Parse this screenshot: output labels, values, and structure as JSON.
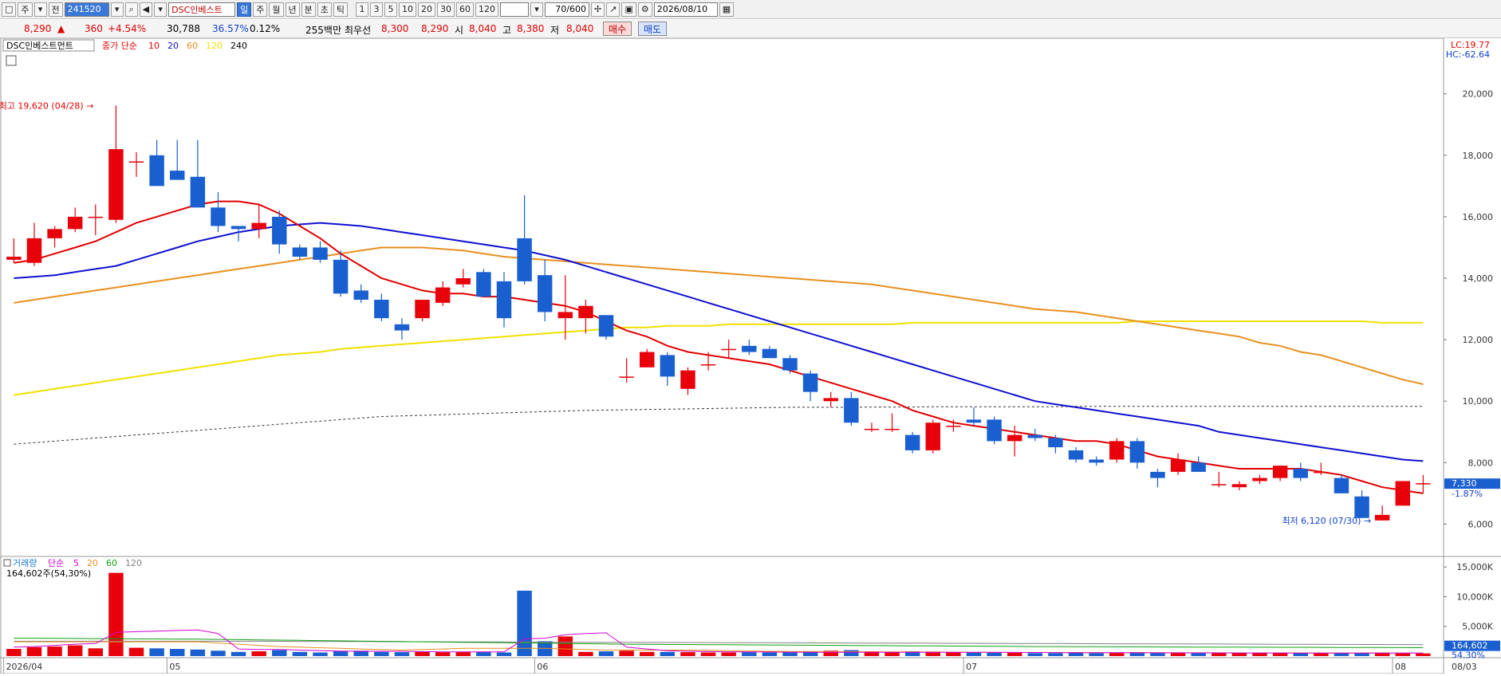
{
  "toolbar": {
    "items": [
      {
        "name": "window-menu-icon",
        "label": "□"
      },
      {
        "name": "market-select",
        "label": "주"
      },
      {
        "name": "market-dropdown-icon",
        "label": "▾"
      },
      {
        "name": "prev-button",
        "label": "전"
      }
    ],
    "code": "241520",
    "name": "DSC인베스트",
    "period_buttons": [
      "일",
      "주",
      "월",
      "년",
      "분",
      "초",
      "틱"
    ],
    "interval_buttons": [
      "1",
      "3",
      "5",
      "10",
      "20",
      "30",
      "60",
      "120"
    ],
    "count": "70/600",
    "date": "2026/08/10",
    "colors": {
      "accent": "#3a78d8"
    }
  },
  "quote": {
    "price": "8,290",
    "change_arrow": "▲",
    "change": "360",
    "change_pct": "+4.54%",
    "volume": "30,788",
    "vol_ratio": "36.57%",
    "turnover": "0.12%",
    "amount": "255백만",
    "best_ask_label": "최우선",
    "best_ask": "8,300",
    "best_bid": "8,290",
    "open_label": "시",
    "open": "8,040",
    "high_label": "고",
    "high": "8,380",
    "low_label": "저",
    "low": "8,040",
    "buy_label": "매수",
    "sell_label": "매도"
  },
  "chart_data": {
    "type": "candlestick",
    "title": "DSC인베스트먼트",
    "ma_legend": {
      "label": "종가 단순",
      "periods": [
        "10",
        "20",
        "60",
        "120",
        "240"
      ],
      "colors": [
        "#e00000",
        "#1010d0",
        "#e89020",
        "#f0e000",
        "#000000"
      ]
    },
    "lc_label": "LC:19.77",
    "hc_label": "HC:-62.64",
    "y_ticks": [
      "20,000",
      "18,000",
      "16,000",
      "14,000",
      "12,000",
      "10,000",
      "8,000",
      "6,000"
    ],
    "ylim": [
      5000,
      21600
    ],
    "max_annotation": "최고 19,620 (04/28)",
    "min_annotation": "최저 6,120 (07/30)",
    "current_price_label": "7,330",
    "current_change_label": "-1.87%",
    "x_labels": [
      {
        "label": "2026/04",
        "index": 0
      },
      {
        "label": "05",
        "index": 8
      },
      {
        "label": "06",
        "index": 26
      },
      {
        "label": "07",
        "index": 47
      },
      {
        "label": "08",
        "index": 68
      },
      {
        "label": "08/03",
        "index": 73
      }
    ],
    "candles": [
      [
        14600,
        15300,
        14500,
        14700
      ],
      [
        14500,
        15800,
        14400,
        15300
      ],
      [
        15300,
        15700,
        15000,
        15600
      ],
      [
        15600,
        16300,
        15500,
        16000
      ],
      [
        16000,
        16400,
        15400,
        16000
      ],
      [
        15900,
        19620,
        15800,
        18200
      ],
      [
        17800,
        18100,
        17300,
        17800
      ],
      [
        18000,
        18500,
        17000,
        17000
      ],
      [
        17500,
        18500,
        17200,
        17200
      ],
      [
        17300,
        18500,
        16400,
        16300
      ],
      [
        16300,
        16800,
        15500,
        15700
      ],
      [
        15700,
        15700,
        15200,
        15600
      ],
      [
        15600,
        16400,
        15300,
        15800
      ],
      [
        16000,
        16200,
        14800,
        15100
      ],
      [
        15000,
        15100,
        14600,
        14700
      ],
      [
        15000,
        15200,
        14500,
        14600
      ],
      [
        14600,
        14900,
        13400,
        13500
      ],
      [
        13600,
        13800,
        13200,
        13300
      ],
      [
        13300,
        13500,
        12600,
        12700
      ],
      [
        12500,
        12700,
        12000,
        12300
      ],
      [
        12700,
        13300,
        12600,
        13300
      ],
      [
        13200,
        13900,
        13100,
        13700
      ],
      [
        13800,
        14300,
        13700,
        14000
      ],
      [
        14200,
        14300,
        13400,
        13400
      ],
      [
        13900,
        14200,
        12400,
        12700
      ],
      [
        15300,
        16700,
        13800,
        13900
      ],
      [
        14100,
        14600,
        12600,
        12900
      ],
      [
        12700,
        14100,
        12000,
        12900
      ],
      [
        12700,
        13300,
        12200,
        13100
      ],
      [
        12800,
        12800,
        12000,
        12100
      ],
      [
        10800,
        11400,
        10600,
        10800
      ],
      [
        11100,
        11700,
        11100,
        11600
      ],
      [
        11500,
        11600,
        10500,
        10800
      ],
      [
        10400,
        11100,
        10200,
        11000
      ],
      [
        11200,
        11600,
        11000,
        11200
      ],
      [
        11700,
        12000,
        11400,
        11700
      ],
      [
        11800,
        12000,
        11500,
        11600
      ],
      [
        11700,
        11800,
        11400,
        11400
      ],
      [
        11400,
        11500,
        10900,
        11000
      ],
      [
        10900,
        11000,
        10000,
        10300
      ],
      [
        10000,
        10300,
        9800,
        10100
      ],
      [
        10100,
        10300,
        9200,
        9300
      ],
      [
        9100,
        9300,
        9000,
        9100
      ],
      [
        9100,
        9600,
        9000,
        9100
      ],
      [
        8900,
        9000,
        8300,
        8400
      ],
      [
        8400,
        9400,
        8300,
        9300
      ],
      [
        9200,
        9400,
        9000,
        9200
      ],
      [
        9400,
        9800,
        9200,
        9300
      ],
      [
        9400,
        9500,
        8600,
        8700
      ],
      [
        8700,
        9200,
        8200,
        8900
      ],
      [
        8900,
        9100,
        8700,
        8800
      ],
      [
        8800,
        8900,
        8300,
        8500
      ],
      [
        8400,
        8500,
        8000,
        8100
      ],
      [
        8100,
        8200,
        7900,
        8000
      ],
      [
        8100,
        8800,
        8000,
        8700
      ],
      [
        8700,
        8800,
        7800,
        8000
      ],
      [
        7700,
        7800,
        7200,
        7500
      ],
      [
        7700,
        8300,
        7600,
        8100
      ],
      [
        8000,
        8200,
        7700,
        7700
      ],
      [
        7300,
        7700,
        7200,
        7300
      ],
      [
        7200,
        7400,
        7100,
        7300
      ],
      [
        7400,
        7600,
        7300,
        7500
      ],
      [
        7500,
        7900,
        7400,
        7900
      ],
      [
        7800,
        8000,
        7400,
        7500
      ],
      [
        7700,
        8000,
        7600,
        7700
      ],
      [
        7500,
        7600,
        7000,
        7000
      ],
      [
        6900,
        7100,
        6200,
        6200
      ],
      [
        6120,
        6600,
        6120,
        6300
      ],
      [
        6600,
        7400,
        6600,
        7400
      ],
      [
        7300,
        7600,
        7000,
        7330
      ]
    ],
    "ma10": [
      14500,
      14600,
      14800,
      15000,
      15200,
      15500,
      15800,
      16000,
      16200,
      16400,
      16500,
      16500,
      16400,
      16100,
      15700,
      15300,
      14800,
      14400,
      14000,
      13800,
      13600,
      13500,
      13500,
      13400,
      13400,
      13300,
      13200,
      13100,
      12900,
      12600,
      12300,
      12100,
      11800,
      11600,
      11500,
      11400,
      11300,
      11200,
      11000,
      10800,
      10600,
      10400,
      10200,
      10000,
      9700,
      9500,
      9300,
      9200,
      9100,
      9000,
      8900,
      8800,
      8700,
      8700,
      8600,
      8400,
      8200,
      8100,
      8000,
      7900,
      7800,
      7800,
      7800,
      7800,
      7700,
      7600,
      7400,
      7200,
      7100,
      7000
    ],
    "ma20": [
      14000,
      14050,
      14100,
      14200,
      14300,
      14400,
      14600,
      14800,
      15000,
      15200,
      15350,
      15500,
      15600,
      15700,
      15750,
      15800,
      15750,
      15700,
      15600,
      15500,
      15400,
      15300,
      15200,
      15100,
      15000,
      14900,
      14750,
      14600,
      14400,
      14200,
      14000,
      13800,
      13600,
      13400,
      13200,
      13000,
      12800,
      12600,
      12400,
      12200,
      12000,
      11800,
      11600,
      11400,
      11200,
      11000,
      10800,
      10600,
      10400,
      10200,
      10000,
      9900,
      9800,
      9700,
      9600,
      9500,
      9400,
      9300,
      9200,
      9000,
      8900,
      8800,
      8700,
      8600,
      8500,
      8400,
      8300,
      8200,
      8100,
      8050
    ],
    "ma60": [
      13200,
      13300,
      13400,
      13500,
      13600,
      13700,
      13800,
      13900,
      14000,
      14100,
      14200,
      14300,
      14400,
      14500,
      14600,
      14700,
      14800,
      14900,
      15000,
      15000,
      15000,
      14950,
      14900,
      14800,
      14700,
      14650,
      14600,
      14550,
      14500,
      14450,
      14400,
      14350,
      14300,
      14250,
      14200,
      14150,
      14100,
      14050,
      14000,
      13950,
      13900,
      13850,
      13800,
      13700,
      13600,
      13500,
      13400,
      13300,
      13200,
      13100,
      13000,
      12950,
      12900,
      12800,
      12700,
      12600,
      12500,
      12400,
      12300,
      12200,
      12100,
      11900,
      11800,
      11600,
      11500,
      11300,
      11100,
      10900,
      10700,
      10550
    ],
    "ma120": [
      10200,
      10300,
      10400,
      10500,
      10600,
      10700,
      10800,
      10900,
      11000,
      11100,
      11200,
      11300,
      11400,
      11500,
      11550,
      11600,
      11700,
      11750,
      11800,
      11850,
      11900,
      11950,
      12000,
      12050,
      12100,
      12150,
      12200,
      12250,
      12300,
      12350,
      12400,
      12400,
      12450,
      12450,
      12450,
      12500,
      12500,
      12500,
      12500,
      12500,
      12500,
      12500,
      12500,
      12500,
      12550,
      12550,
      12550,
      12550,
      12550,
      12550,
      12550,
      12550,
      12550,
      12550,
      12550,
      12600,
      12600,
      12600,
      12600,
      12600,
      12600,
      12600,
      12600,
      12600,
      12600,
      12600,
      12600,
      12550,
      12550,
      12550
    ],
    "ma240": [
      8600,
      8650,
      8700,
      8750,
      8800,
      8850,
      8900,
      8950,
      9000,
      9050,
      9100,
      9150,
      9200,
      9250,
      9300,
      9350,
      9400,
      9450,
      9500,
      9520,
      9540,
      9560,
      9580,
      9600,
      9620,
      9640,
      9660,
      9680,
      9700,
      9710,
      9720,
      9730,
      9740,
      9750,
      9760,
      9770,
      9780,
      9790,
      9800,
      9800,
      9800,
      9800,
      9810,
      9810,
      9810,
      9820,
      9820,
      9820,
      9820,
      9820,
      9820,
      9820,
      9830,
      9830,
      9830,
      9830,
      9830,
      9830,
      9830,
      9830,
      9830,
      9830,
      9830,
      9830,
      9830,
      9830,
      9830,
      9830,
      9830,
      9830
    ]
  },
  "volume_panel": {
    "label": "거래량",
    "ma_label": "단순",
    "ma_periods": [
      "5",
      "20",
      "60",
      "120"
    ],
    "ma_colors": [
      "#d000d0",
      "#e89020",
      "#10a010",
      "#808080"
    ],
    "info": "164,602주(54,30%)",
    "y_ticks": [
      "15,000K",
      "10,000K",
      "5,000K"
    ],
    "ylim": [
      0,
      16500
    ],
    "current_volume_label": "164,602",
    "current_pct_label": "54.30%",
    "volumes": [
      1200,
      1500,
      1600,
      1800,
      1300,
      14000,
      1400,
      1300,
      1200,
      1100,
      900,
      700,
      800,
      1000,
      700,
      600,
      800,
      900,
      700,
      650,
      700,
      650,
      700,
      700,
      600,
      11000,
      2500,
      3300,
      700,
      800,
      900,
      700,
      700,
      650,
      600,
      600,
      650,
      600,
      700,
      800,
      900,
      1000,
      800,
      700,
      800,
      750,
      700,
      650,
      600,
      550,
      500,
      500,
      550,
      500,
      600,
      650,
      550,
      550,
      500,
      500,
      500,
      550,
      500,
      500,
      500,
      500,
      550,
      600,
      500,
      450
    ],
    "ma5": [
      1500,
      1600,
      1800,
      2000,
      2100,
      4000,
      4100,
      4200,
      4300,
      4400,
      3800,
      1200,
      1100,
      1100,
      1000,
      900,
      850,
      800,
      800,
      800,
      750,
      700,
      700,
      700,
      700,
      2900,
      3000,
      3600,
      3800,
      3900,
      1500,
      1200,
      900,
      800,
      750,
      700,
      700,
      680,
      660,
      650,
      650,
      650,
      650,
      650,
      650,
      650,
      650,
      650,
      640,
      620,
      600,
      590,
      580,
      570,
      560,
      550,
      550,
      550,
      540,
      530,
      520,
      520,
      520,
      510,
      510,
      510,
      510,
      510,
      500,
      500
    ],
    "ma20": [
      2400,
      2400,
      2400,
      2400,
      2400,
      2400,
      2400,
      2400,
      2400,
      2400,
      2200,
      2000,
      1800,
      1600,
      1500,
      1400,
      1300,
      1200,
      1100,
      1000,
      1100,
      1200,
      1300,
      1300,
      1300,
      1300,
      1300,
      1200,
      1100,
      1000,
      1000,
      1000,
      1000,
      1000,
      950,
      900,
      850,
      800,
      780,
      760,
      740,
      720,
      700,
      700,
      700,
      680,
      660,
      640,
      620,
      600,
      600,
      600,
      600,
      580,
      560,
      560,
      560,
      550,
      550,
      550,
      540,
      540,
      530,
      530,
      520,
      520,
      520,
      520,
      510,
      510
    ],
    "ma60": [
      3000,
      3000,
      2980,
      2960,
      2940,
      2920,
      2900,
      2880,
      2860,
      2840,
      2800,
      2760,
      2720,
      2680,
      2640,
      2600,
      2560,
      2520,
      2480,
      2440,
      2400,
      2360,
      2320,
      2280,
      2240,
      2200,
      2160,
      2120,
      2080,
      2040,
      2000,
      1980,
      1960,
      1940,
      1920,
      1900,
      1880,
      1860,
      1840,
      1820,
      1800,
      1780,
      1760,
      1740,
      1720,
      1700,
      1680,
      1660,
      1640,
      1620,
      1600,
      1590,
      1580,
      1570,
      1560,
      1550,
      1540,
      1530,
      1520,
      1510,
      1500,
      1490,
      1480,
      1470,
      1460,
      1450,
      1440,
      1430,
      1420,
      1410
    ],
    "ma120": [
      2500,
      2500,
      2500,
      2500,
      2500,
      2500,
      2500,
      2500,
      2500,
      2500,
      2500,
      2500,
      2490,
      2480,
      2470,
      2460,
      2450,
      2440,
      2430,
      2420,
      2410,
      2400,
      2390,
      2380,
      2370,
      2360,
      2350,
      2340,
      2330,
      2320,
      2310,
      2300,
      2290,
      2280,
      2270,
      2260,
      2250,
      2240,
      2230,
      2220,
      2210,
      2200,
      2190,
      2180,
      2170,
      2160,
      2150,
      2140,
      2130,
      2120,
      2110,
      2100,
      2090,
      2080,
      2070,
      2060,
      2050,
      2040,
      2030,
      2020,
      2010,
      2000,
      1990,
      1980,
      1970,
      1960,
      1950,
      1940,
      1930,
      1920
    ]
  }
}
